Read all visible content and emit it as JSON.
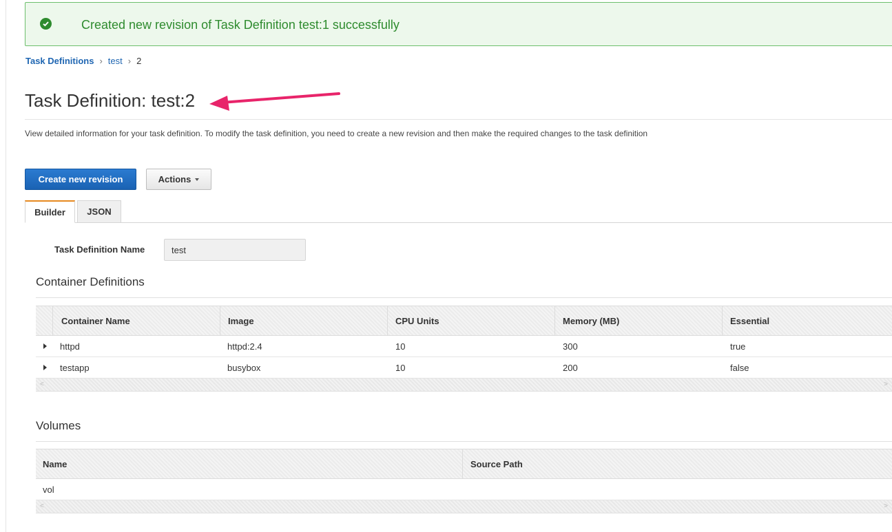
{
  "flash": {
    "message": "Created new revision of Task Definition test:1 successfully",
    "icon": "check-circle-icon",
    "color": "#2e8b2e"
  },
  "breadcrumb": {
    "root": "Task Definitions",
    "family": "test",
    "revision": "2"
  },
  "page": {
    "title": "Task Definition: test:2",
    "description": "View detailed information for your task definition. To modify the task definition, you need to create a new revision and then make the required changes to the task definition"
  },
  "buttons": {
    "create_revision": "Create new revision",
    "actions": "Actions"
  },
  "tabs": [
    {
      "label": "Builder",
      "active": true
    },
    {
      "label": "JSON",
      "active": false
    }
  ],
  "form": {
    "name_label": "Task Definition Name",
    "name_value": "test"
  },
  "containers": {
    "title": "Container Definitions",
    "columns": [
      "Container Name",
      "Image",
      "CPU Units",
      "Memory (MB)",
      "Essential"
    ],
    "rows": [
      [
        "httpd",
        "httpd:2.4",
        "10",
        "300",
        "true"
      ],
      [
        "testapp",
        "busybox",
        "10",
        "200",
        "false"
      ]
    ]
  },
  "volumes": {
    "title": "Volumes",
    "columns": [
      "Name",
      "Source Path"
    ],
    "rows": [
      [
        "vol",
        ""
      ]
    ]
  },
  "colors": {
    "primary": "#1a62b3",
    "link": "#1f66b2",
    "success": "#2e8b2e",
    "tab_accent": "#e7891f",
    "annotation_arrow": "#e8246a"
  }
}
